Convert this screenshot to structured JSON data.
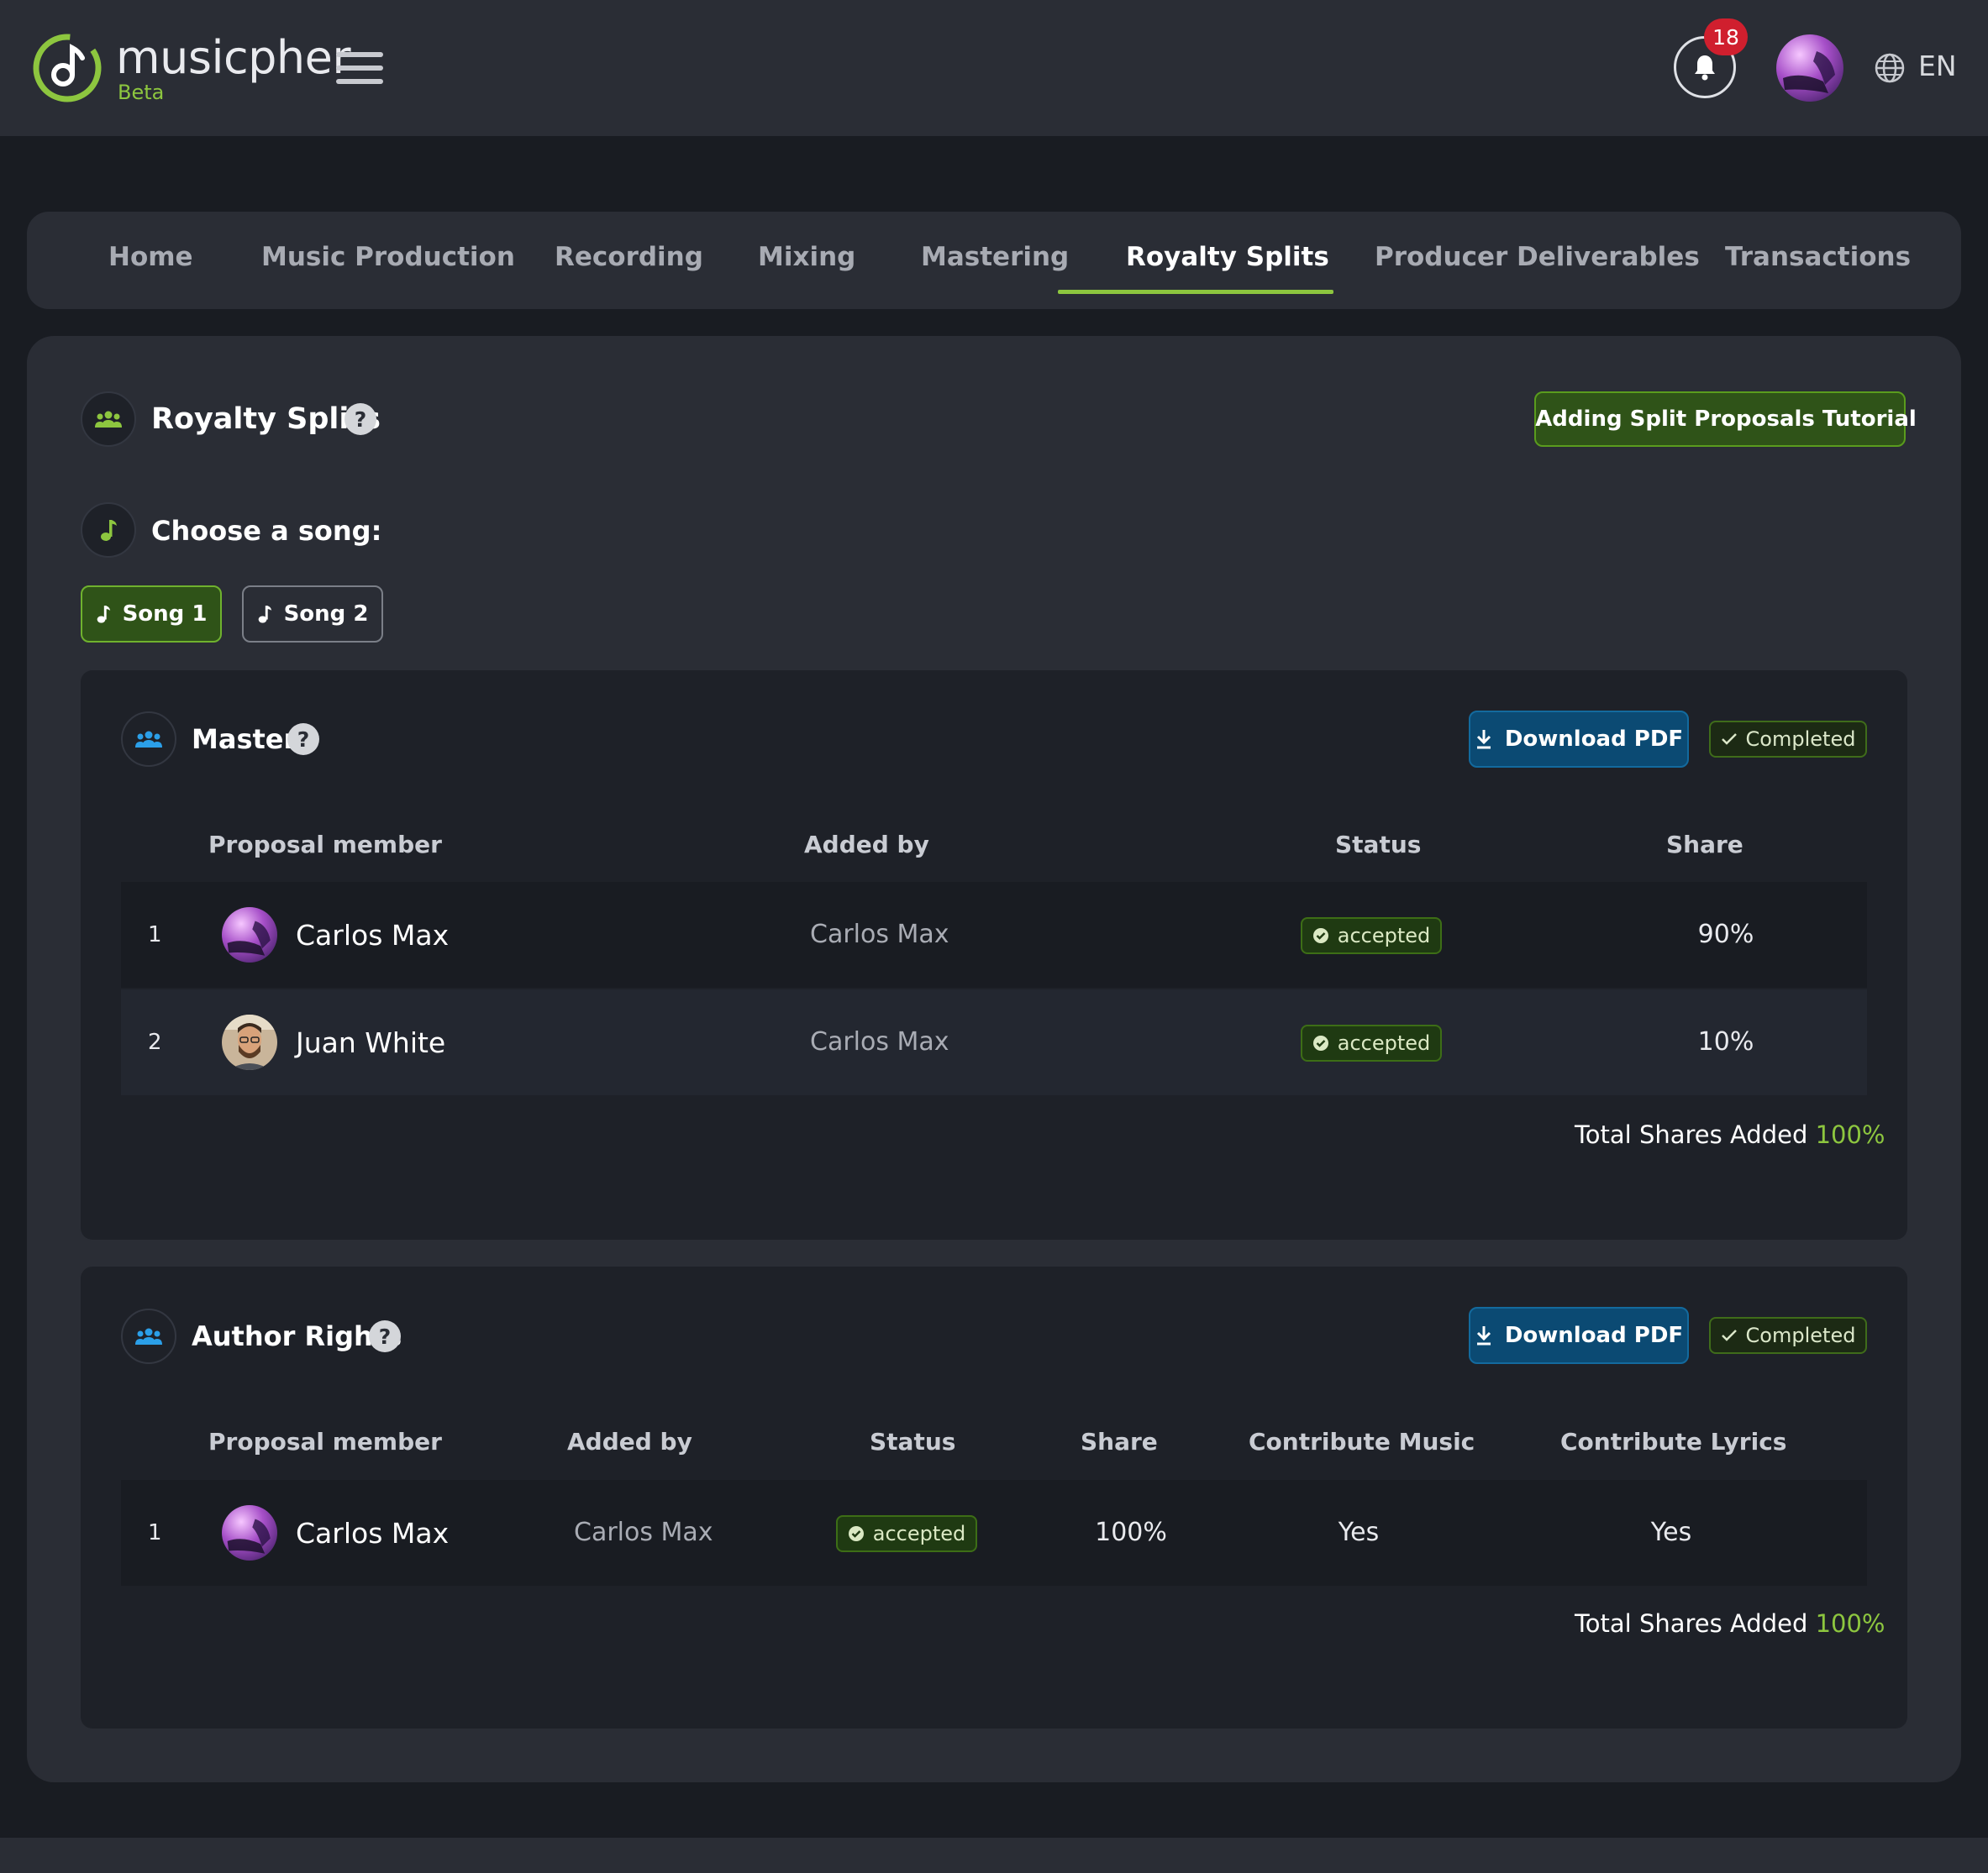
{
  "brand": {
    "name": "musicpher",
    "tag": "Beta",
    "accent": "#8dc63f"
  },
  "header": {
    "notification_count": "18",
    "language": "EN"
  },
  "nav": {
    "tabs": [
      {
        "label": "Home"
      },
      {
        "label": "Music Production"
      },
      {
        "label": "Recording"
      },
      {
        "label": "Mixing"
      },
      {
        "label": "Mastering"
      },
      {
        "label": "Royalty Splits",
        "active": true
      },
      {
        "label": "Producer Deliverables"
      },
      {
        "label": "Transactions"
      }
    ]
  },
  "page": {
    "title": "Royalty Splits",
    "help": "?",
    "tutorial_label": "Adding Split Proposals Tutorial",
    "choose_label": "Choose a song:",
    "songs": [
      {
        "label": "Song 1",
        "selected": true
      },
      {
        "label": "Song 2",
        "selected": false
      }
    ]
  },
  "master": {
    "title": "Master",
    "download_label": "Download PDF",
    "completed_label": "Completed",
    "headers": [
      "Proposal member",
      "Added by",
      "Status",
      "Share"
    ],
    "rows": [
      {
        "num": "1",
        "member": "Carlos Max",
        "added_by": "Carlos Max",
        "status": "accepted",
        "share": "90%"
      },
      {
        "num": "2",
        "member": "Juan White",
        "added_by": "Carlos Max",
        "status": "accepted",
        "share": "10%"
      }
    ],
    "total_label": "Total Shares Added",
    "total_value": "100%"
  },
  "author": {
    "title": "Author Rights",
    "download_label": "Download PDF",
    "completed_label": "Completed",
    "headers": [
      "Proposal member",
      "Added by",
      "Status",
      "Share",
      "Contribute Music",
      "Contribute Lyrics"
    ],
    "rows": [
      {
        "num": "1",
        "member": "Carlos Max",
        "added_by": "Carlos Max",
        "status": "accepted",
        "share": "100%",
        "music": "Yes",
        "lyrics": "Yes"
      }
    ],
    "total_label": "Total Shares Added",
    "total_value": "100%"
  },
  "icons": {
    "logo": "music-note-logo",
    "menu": "hamburger-icon",
    "bell": "bell-icon",
    "globe": "globe-icon",
    "group": "users-icon",
    "note": "music-note-icon",
    "download": "download-icon",
    "check": "check-icon",
    "tutorial": "video-icon"
  }
}
